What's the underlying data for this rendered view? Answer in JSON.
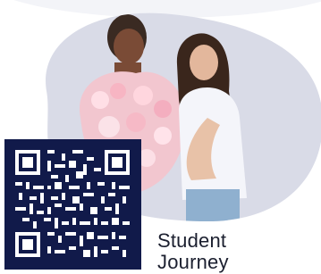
{
  "colors": {
    "qr_background": "#111a4a",
    "blob_background": "#d9dbe7",
    "caption_text": "#1b1f2f"
  },
  "image": {
    "icon": "two-students-photo"
  },
  "qr": {
    "icon": "qr-code-icon"
  },
  "caption": {
    "line1": "Student",
    "line2": "Journey"
  }
}
